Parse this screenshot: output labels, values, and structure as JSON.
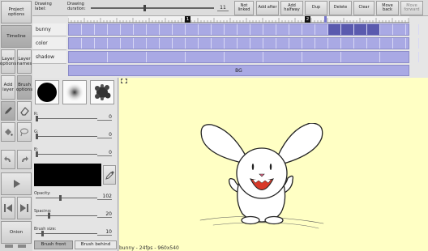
{
  "sidebar": {
    "project_options": "Project options",
    "timeline": "Timeline",
    "layer_options": "Layer options",
    "layer_names": "Layer names",
    "add_layer": "Add layer",
    "brush_options": "Brush options",
    "onion": "Onion"
  },
  "toolbar": {
    "drawing_label": "Drawing label:",
    "drawing_duration": "Drawing duration:",
    "duration_value": "11",
    "not_linked": "Not linked",
    "add_after": "Add after",
    "add_halfway": "Add halfway",
    "dup": "Dup",
    "delete": "Delete",
    "clear": "Clear",
    "move_back": "Move back",
    "move_forward": "Move forward"
  },
  "timeline": {
    "markers": [
      "1",
      "2"
    ],
    "layers": [
      "bunny",
      "color",
      "shadow"
    ],
    "bg_label": "BG"
  },
  "tools": {
    "sliders": [
      {
        "label": "R:",
        "value": "0",
        "fraction": 0.0
      },
      {
        "label": "G:",
        "value": "0",
        "fraction": 0.0
      },
      {
        "label": "B:",
        "value": "0",
        "fraction": 0.0
      },
      {
        "label": "Opacity:",
        "value": "102",
        "fraction": 0.4
      },
      {
        "label": "Spacing:",
        "value": "20",
        "fraction": 0.2
      },
      {
        "label": "Brush size:",
        "value": "10",
        "fraction": 0.1
      }
    ],
    "brush_front": "Brush front",
    "brush_behind": "Brush behind",
    "current_color": "#000000"
  },
  "canvas": {
    "status": "bunny - 24fps - 960x540",
    "background_color": "#ffffc4"
  },
  "colors": {
    "track": "#a9a9e4",
    "selected": "#5a5aae"
  }
}
